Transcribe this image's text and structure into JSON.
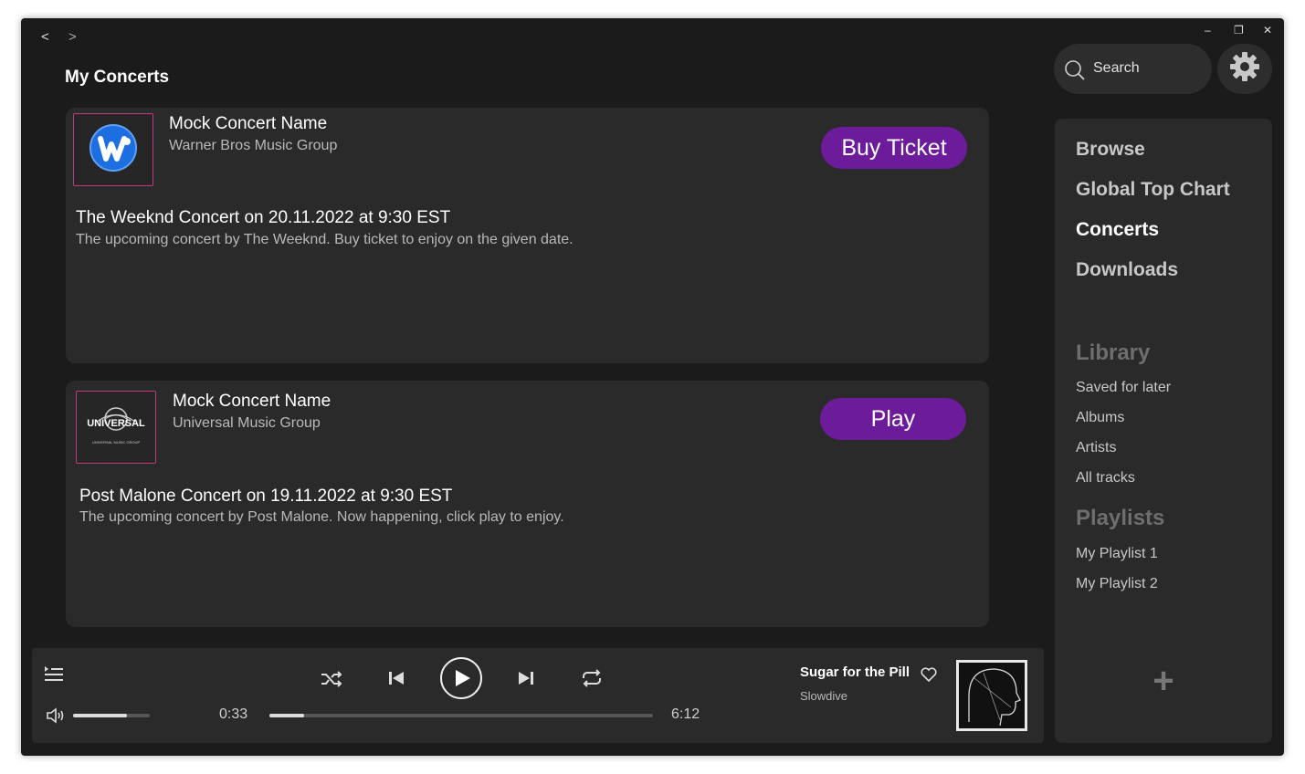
{
  "nav": {
    "back": "<",
    "forward": ">"
  },
  "window_controls": {
    "minimize": "–",
    "restore": "❐",
    "close": "✕"
  },
  "page_title": "My Concerts",
  "concerts": [
    {
      "name": "Mock Concert Name",
      "organizer": "Warner Bros Music Group",
      "title": "The Weeknd Concert on 20.11.2022 at 9:30 EST",
      "description": "The upcoming concert by The Weeknd. Buy ticket to enjoy on the given date.",
      "button": "Buy Ticket",
      "logo": "warner-logo"
    },
    {
      "name": "Mock Concert Name",
      "organizer": "Universal Music Group",
      "title": "Post Malone Concert on 19.11.2022 at 9:30 EST",
      "description": "The upcoming concert by Post Malone. Now happening, click play to enjoy.",
      "button": "Play",
      "logo": "universal-logo",
      "logo_text": "UNIVERSAL",
      "logo_subtext": "UNIVERSAL MUSIC GROUP"
    }
  ],
  "player": {
    "elapsed": "0:33",
    "duration": "6:12",
    "progress": 0.09,
    "volume": 0.7,
    "track_title": "Sugar for the Pill",
    "artist": "Slowdive"
  },
  "search": {
    "placeholder": "Search"
  },
  "sidebar": {
    "main": [
      "Browse",
      "Global Top Chart",
      "Concerts",
      "Downloads"
    ],
    "active": "Concerts",
    "library_heading": "Library",
    "library": [
      "Saved for later",
      "Albums",
      "Artists",
      "All tracks"
    ],
    "playlists_heading": "Playlists",
    "playlists": [
      "My Playlist 1",
      "My Playlist 2"
    ],
    "add": "+"
  },
  "colors": {
    "accent": "#6c1b9b",
    "logo_border": "#c0397a",
    "background": "#1b1b1b",
    "panel": "#2a2a2a"
  }
}
